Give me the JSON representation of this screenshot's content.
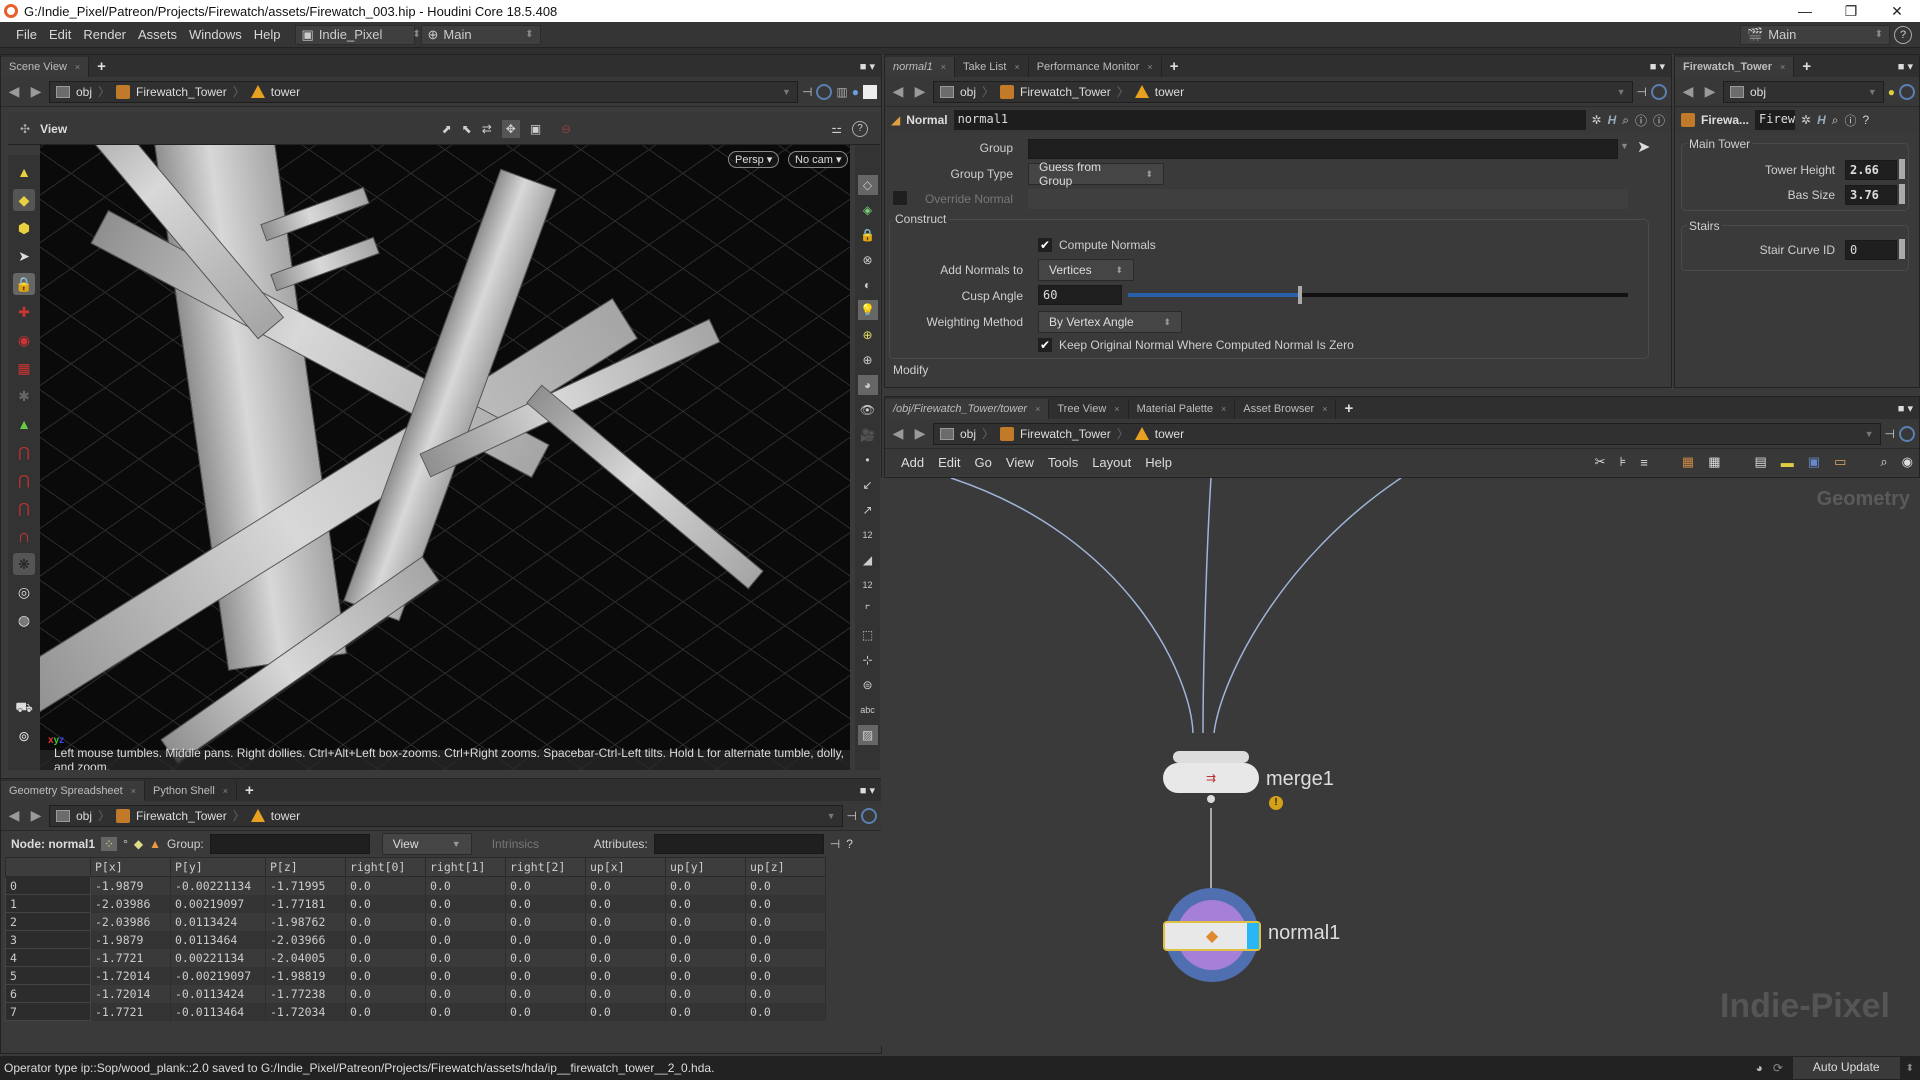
{
  "window": {
    "title": "G:/Indie_Pixel/Patreon/Projects/Firewatch/assets/Firewatch_003.hip - Houdini Core 18.5.408",
    "minimize": "—",
    "maximize": "❐",
    "close": "✕"
  },
  "menubar": {
    "items": [
      "File",
      "Edit",
      "Render",
      "Assets",
      "Windows",
      "Help"
    ],
    "desktop": "Indie_Pixel",
    "context": "Main",
    "right_context": "Main",
    "help": "?"
  },
  "breadcrumb": {
    "obj": "obj",
    "asset": "Firewatch_Tower",
    "geo": "tower"
  },
  "scene_view": {
    "tab": "Scene View",
    "header_label": "View",
    "persp": "Persp ▾",
    "cam": "No cam ▾",
    "hint": "Left mouse tumbles. Middle pans. Right dollies. Ctrl+Alt+Left box-zooms. Ctrl+Right zooms. Spacebar-Ctrl-Left tilts. Hold L for alternate tumble, dolly, and zoom.",
    "axis_x": "x",
    "axis_y": "y",
    "axis_z": "z",
    "left_tools": [
      "object-mode-icon",
      "geometry-mode-icon",
      "component-mode-icon",
      "select-arrow-icon",
      "lock-icon",
      "transform-icon",
      "rotate-icon",
      "scale-icon",
      "handle-icon",
      "paint-icon",
      "magnet-grid-icon",
      "magnet-curve-icon",
      "magnet-point-icon",
      "magnet-icon",
      "snap-icon",
      "view-icon",
      "camera-icon",
      "render-icon",
      "flipbook-icon"
    ],
    "right_tools": [
      "display-options-icon",
      "ghost-icon",
      "lock-camera-icon",
      "light-off-icon",
      "headlight-icon",
      "light-icon",
      "add-light-icon",
      "light-link-icon",
      "shading-icon",
      "visibility-icon",
      "camera-view-icon",
      "point-icon",
      "normal-icon",
      "point-normal-icon",
      "point-number-icon",
      "prim-icon",
      "prim-number-icon",
      "edge-icon",
      "bound-icon",
      "origin-icon",
      "background-icon",
      "text-icon",
      "image-icon"
    ],
    "right_tools_labels": {
      "point_num": "12",
      "prim_num": "12",
      "abc": "abc"
    }
  },
  "param_pane": {
    "tabs": [
      {
        "label": "normal1",
        "active": true
      },
      {
        "label": "Take List",
        "active": false
      },
      {
        "label": "Performance Monitor",
        "active": false
      }
    ],
    "node_type": "Normal",
    "node_name": "normal1",
    "fields": {
      "group_label": "Group",
      "group_value": "",
      "group_type_label": "Group Type",
      "group_type_value": "Guess from Group",
      "override_normal_label": "Override Normal",
      "construct_title": "Construct",
      "compute_normals_label": "Compute Normals",
      "compute_normals_checked": true,
      "add_normals_label": "Add Normals to",
      "add_normals_value": "Vertices",
      "cusp_angle_label": "Cusp Angle",
      "cusp_angle_value": "60",
      "cusp_angle_slider_fraction": 0.34,
      "weighting_label": "Weighting Method",
      "weighting_value": "By Vertex Angle",
      "keep_original_label": "Keep Original Normal Where Computed Normal Is Zero",
      "keep_original_checked": true,
      "modify_title": "Modify"
    }
  },
  "asset_pane": {
    "tab": "Firewatch_Tower",
    "path": "obj",
    "node_type_short": "Firewa...",
    "node_name_short": "Firew",
    "main_tower_title": "Main Tower",
    "tower_height_label": "Tower Height",
    "tower_height_value": "2.66",
    "bas_size_label": "Bas Size",
    "bas_size_value": "3.76",
    "stairs_title": "Stairs",
    "stair_curve_label": "Stair Curve ID",
    "stair_curve_value": "0"
  },
  "spreadsheet": {
    "tabs": [
      {
        "label": "Geometry Spreadsheet",
        "active": true
      },
      {
        "label": "Python Shell",
        "active": false
      }
    ],
    "node_label": "Node: normal1",
    "group_label": "Group:",
    "view_label": "View",
    "intrinsics_label": "Intrinsics",
    "attributes_label": "Attributes:",
    "columns": [
      "",
      "P[x]",
      "P[y]",
      "P[z]",
      "right[0]",
      "right[1]",
      "right[2]",
      "up[x]",
      "up[y]",
      "up[z]"
    ],
    "rows": [
      [
        "0",
        "-1.9879",
        "-0.00221134",
        "-1.71995",
        "0.0",
        "0.0",
        "0.0",
        "0.0",
        "0.0",
        "0.0"
      ],
      [
        "1",
        "-2.03986",
        "0.00219097",
        "-1.77181",
        "0.0",
        "0.0",
        "0.0",
        "0.0",
        "0.0",
        "0.0"
      ],
      [
        "2",
        "-2.03986",
        "0.0113424",
        "-1.98762",
        "0.0",
        "0.0",
        "0.0",
        "0.0",
        "0.0",
        "0.0"
      ],
      [
        "3",
        "-1.9879",
        "0.0113464",
        "-2.03966",
        "0.0",
        "0.0",
        "0.0",
        "0.0",
        "0.0",
        "0.0"
      ],
      [
        "4",
        "-1.7721",
        "0.00221134",
        "-2.04005",
        "0.0",
        "0.0",
        "0.0",
        "0.0",
        "0.0",
        "0.0"
      ],
      [
        "5",
        "-1.72014",
        "-0.00219097",
        "-1.98819",
        "0.0",
        "0.0",
        "0.0",
        "0.0",
        "0.0",
        "0.0"
      ],
      [
        "6",
        "-1.72014",
        "-0.0113424",
        "-1.77238",
        "0.0",
        "0.0",
        "0.0",
        "0.0",
        "0.0",
        "0.0"
      ],
      [
        "7",
        "-1.7721",
        "-0.0113464",
        "-1.72034",
        "0.0",
        "0.0",
        "0.0",
        "0.0",
        "0.0",
        "0.0"
      ]
    ]
  },
  "network": {
    "tabs": [
      {
        "label": "/obj/Firewatch_Tower/tower",
        "active": true
      },
      {
        "label": "Tree View",
        "active": false
      },
      {
        "label": "Material Palette",
        "active": false
      },
      {
        "label": "Asset Browser",
        "active": false
      }
    ],
    "menu": [
      "Add",
      "Edit",
      "Go",
      "View",
      "Tools",
      "Layout",
      "Help"
    ],
    "context_label": "Geometry",
    "nodes": [
      {
        "name": "merge1",
        "warning": true
      },
      {
        "name": "normal1",
        "display": true
      }
    ],
    "watermark": "Indie-Pixel"
  },
  "statusbar": {
    "message": "Operator type ip::Sop/wood_plank::2.0 saved to G:/Indie_Pixel/Patreon/Projects/Firewatch/assets/hda/ip__firewatch_tower__2_0.hda.",
    "auto_update": "Auto Update"
  },
  "colors": {
    "accent_blue": "#1e88e5",
    "display_flag": "#29b6f6",
    "highlight_yellow": "#e0c040",
    "warning": "#d4a017"
  }
}
